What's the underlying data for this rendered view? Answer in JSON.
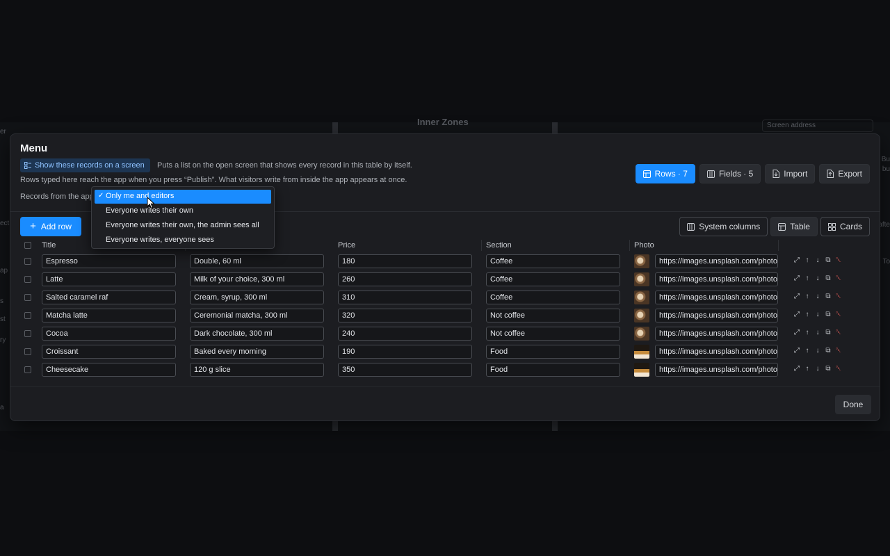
{
  "background": {
    "title": "Inner Zones",
    "address_placeholder": "Screen address",
    "left_fragments": [
      "er",
      "ect",
      "ap",
      "s",
      "st",
      "ry",
      "a"
    ],
    "right_fragments": [
      "Bu",
      "bu",
      "afte",
      "To"
    ]
  },
  "modal": {
    "title": "Menu",
    "show_button_label": "Show these records on a screen",
    "show_description": "Puts a list on the open screen that shows every record in this table by itself.",
    "rows_description": "Rows typed here reach the app when you press “Publish”. What visitors write from inside the app appears at once.",
    "records_label": "Records from the app",
    "top_actions": [
      {
        "label": "Rows · 7",
        "icon": "rows-icon"
      },
      {
        "label": "Fields · 5",
        "icon": "columns-icon"
      },
      {
        "label": "Import",
        "icon": "file-import-icon"
      },
      {
        "label": "Export",
        "icon": "file-export-icon"
      }
    ],
    "add_row_label": "Add row",
    "view_actions": [
      {
        "label": "System columns",
        "icon": "columns-icon"
      },
      {
        "label": "Table",
        "icon": "table-icon"
      },
      {
        "label": "Cards",
        "icon": "grid-icon"
      }
    ],
    "done_label": "Done"
  },
  "dropdown": {
    "options": [
      "Only me and editors",
      "Everyone writes their own",
      "Everyone writes their own, the admin sees all",
      "Everyone writes, everyone sees"
    ],
    "selected_index": 0,
    "check": "✓"
  },
  "table": {
    "columns": [
      "Title",
      "",
      "Price",
      "Section",
      "Photo"
    ],
    "rows": [
      {
        "title": "Espresso",
        "desc": "Double, 60 ml",
        "price": "180",
        "section": "Coffee",
        "photo_url": "https://images.unsplash.com/photo",
        "photo_kind": "coffee"
      },
      {
        "title": "Latte",
        "desc": "Milk of your choice, 300 ml",
        "price": "260",
        "section": "Coffee",
        "photo_url": "https://images.unsplash.com/photo",
        "photo_kind": "coffee"
      },
      {
        "title": "Salted caramel raf",
        "desc": "Cream, syrup, 300 ml",
        "price": "310",
        "section": "Coffee",
        "photo_url": "https://images.unsplash.com/photo",
        "photo_kind": "coffee"
      },
      {
        "title": "Matcha latte",
        "desc": "Ceremonial matcha, 300 ml",
        "price": "320",
        "section": "Not coffee",
        "photo_url": "https://images.unsplash.com/photo",
        "photo_kind": "coffee"
      },
      {
        "title": "Cocoa",
        "desc": "Dark chocolate, 300 ml",
        "price": "240",
        "section": "Not coffee",
        "photo_url": "https://images.unsplash.com/photo",
        "photo_kind": "coffee"
      },
      {
        "title": "Croissant",
        "desc": "Baked every morning",
        "price": "190",
        "section": "Food",
        "photo_url": "https://images.unsplash.com/photo",
        "photo_kind": "food"
      },
      {
        "title": "Cheesecake",
        "desc": "120 g slice",
        "price": "350",
        "section": "Food",
        "photo_url": "https://images.unsplash.com/photo",
        "photo_kind": "food"
      }
    ],
    "row_action_icons": [
      "expand-icon",
      "arrow-up-icon",
      "arrow-down-icon",
      "copy-icon",
      "trash-icon"
    ]
  },
  "colors": {
    "accent": "#1a8cff",
    "danger": "#f0605a",
    "modal_bg": "#1c1d21"
  }
}
